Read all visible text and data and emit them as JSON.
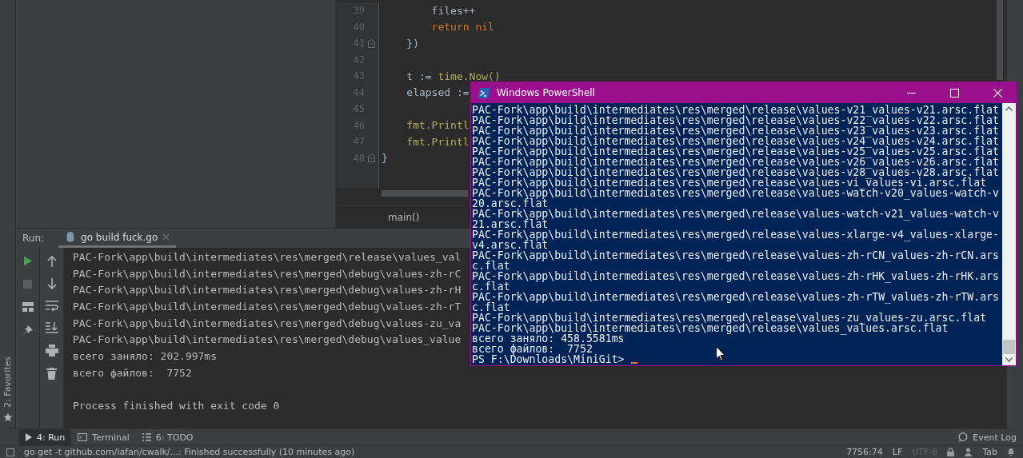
{
  "editor": {
    "lines": [
      {
        "number": "39",
        "fold": false,
        "segments": [
          {
            "text": "        files++",
            "kind": "plain"
          }
        ]
      },
      {
        "number": "40",
        "fold": false,
        "segments": [
          {
            "text": "        return nil",
            "kind": "keyword"
          }
        ]
      },
      {
        "number": "41",
        "fold": true,
        "segments": [
          {
            "text": "    })",
            "kind": "plain"
          }
        ]
      },
      {
        "number": "42",
        "fold": false
      },
      {
        "number": "43",
        "fold": false,
        "segments": [
          {
            "text": "    t := ",
            "kind": "plain"
          },
          {
            "text": "time.",
            "kind": "package"
          },
          {
            "text": "Now()",
            "kind": "call"
          }
        ]
      },
      {
        "number": "44",
        "fold": false,
        "segments": [
          {
            "text": "    elapsed :=",
            "kind": "plain"
          }
        ]
      },
      {
        "number": "45",
        "fold": false
      },
      {
        "number": "46",
        "fold": false,
        "segments": [
          {
            "text": "    fmt.Printl",
            "kind": "package"
          }
        ]
      },
      {
        "number": "47",
        "fold": false,
        "segments": [
          {
            "text": "    fmt.Printl",
            "kind": "package"
          }
        ]
      },
      {
        "number": "48",
        "fold": true,
        "segments": [
          {
            "text": "}",
            "kind": "plain"
          }
        ]
      }
    ],
    "breadcrumb": "main()"
  },
  "run_panel": {
    "label": "Run:",
    "tabs": [
      {
        "label": "go build fuck.go",
        "selected": true
      }
    ],
    "output": [
      "PAC-Fork\\app\\build\\intermediates\\res\\merged\\release\\values_val",
      "PAC-Fork\\app\\build\\intermediates\\res\\merged\\debug\\values-zh-rC",
      "PAC-Fork\\app\\build\\intermediates\\res\\merged\\debug\\values-zh-rH",
      "PAC-Fork\\app\\build\\intermediates\\res\\merged\\debug\\values-zh-rT",
      "PAC-Fork\\app\\build\\intermediates\\res\\merged\\debug\\values-zu_va",
      "PAC-Fork\\app\\build\\intermediates\\res\\merged\\debug\\values_value",
      "всего заняло: 202.997ms",
      "всего файлов:  7752"
    ],
    "exit_message": "Process finished with exit code 0"
  },
  "favorites": "2: Favorites",
  "tool_tabs": [
    {
      "label": "4: Run",
      "selected": true,
      "kind": "run"
    },
    {
      "label": "Terminal",
      "selected": false,
      "kind": "terminal"
    },
    {
      "label": "6: TODO",
      "selected": false,
      "kind": "todo"
    }
  ],
  "event_log": "Event Log",
  "status_bar": {
    "message": "go get -t github.com/iafan/cwalk/...: Finished successfully (10 minutes ago)",
    "position": "7756:74",
    "line_separator": "LF",
    "encoding": "UTF-8",
    "indent": "Tab"
  },
  "powershell": {
    "title": "Windows PowerShell",
    "lines": [
      "PAC-Fork\\app\\build\\intermediates\\res\\merged\\release\\values-v21_values-v21.arsc.flat",
      "PAC-Fork\\app\\build\\intermediates\\res\\merged\\release\\values-v22_values-v22.arsc.flat",
      "PAC-Fork\\app\\build\\intermediates\\res\\merged\\release\\values-v23_values-v23.arsc.flat",
      "PAC-Fork\\app\\build\\intermediates\\res\\merged\\release\\values-v24_values-v24.arsc.flat",
      "PAC-Fork\\app\\build\\intermediates\\res\\merged\\release\\values-v25_values-v25.arsc.flat",
      "PAC-Fork\\app\\build\\intermediates\\res\\merged\\release\\values-v26_values-v26.arsc.flat",
      "PAC-Fork\\app\\build\\intermediates\\res\\merged\\release\\values-v28_values-v28.arsc.flat",
      "PAC-Fork\\app\\build\\intermediates\\res\\merged\\release\\values-vi_values-vi.arsc.flat",
      "PAC-Fork\\app\\build\\intermediates\\res\\merged\\release\\values-watch-v20_values-watch-v",
      "20.arsc.flat",
      "PAC-Fork\\app\\build\\intermediates\\res\\merged\\release\\values-watch-v21_values-watch-v",
      "21.arsc.flat",
      "PAC-Fork\\app\\build\\intermediates\\res\\merged\\release\\values-xlarge-v4_values-xlarge-",
      "v4.arsc.flat",
      "PAC-Fork\\app\\build\\intermediates\\res\\merged\\release\\values-zh-rCN_values-zh-rCN.ars",
      "c.flat",
      "PAC-Fork\\app\\build\\intermediates\\res\\merged\\release\\values-zh-rHK_values-zh-rHK.ars",
      "c.flat",
      "PAC-Fork\\app\\build\\intermediates\\res\\merged\\release\\values-zh-rTW_values-zh-rTW.ars",
      "c.flat",
      "PAC-Fork\\app\\build\\intermediates\\res\\merged\\release\\values-zu_values-zu.arsc.flat",
      "PAC-Fork\\app\\build\\intermediates\\res\\merged\\release\\values_values.arsc.flat",
      "всего заняло: 458.5581ms",
      "всего файлов:  7752",
      "PS F:\\Downloads\\MiniGit> "
    ]
  }
}
